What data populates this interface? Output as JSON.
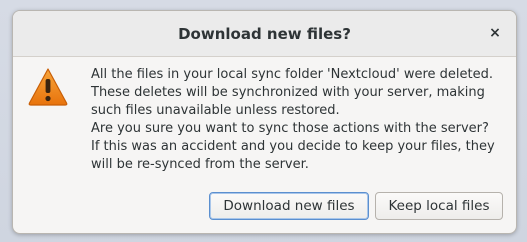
{
  "dialog": {
    "title": "Download new files?",
    "close_glyph": "×",
    "icon": "warning-triangle-icon",
    "message_lines": [
      "All the files in your local sync folder 'Nextcloud' were deleted.",
      "These deletes will be synchronized with your server, making",
      "such files unavailable unless restored.",
      "Are you sure you want to sync those actions with the server?",
      "If this was an accident and you decide to keep your files, they",
      "will be re-synced from the server."
    ],
    "buttons": {
      "download_label": "Download new files",
      "keep_label": "Keep local files"
    }
  },
  "colors": {
    "warning_orange": "#f08a1c",
    "focus_blue": "#5b8fcf"
  }
}
